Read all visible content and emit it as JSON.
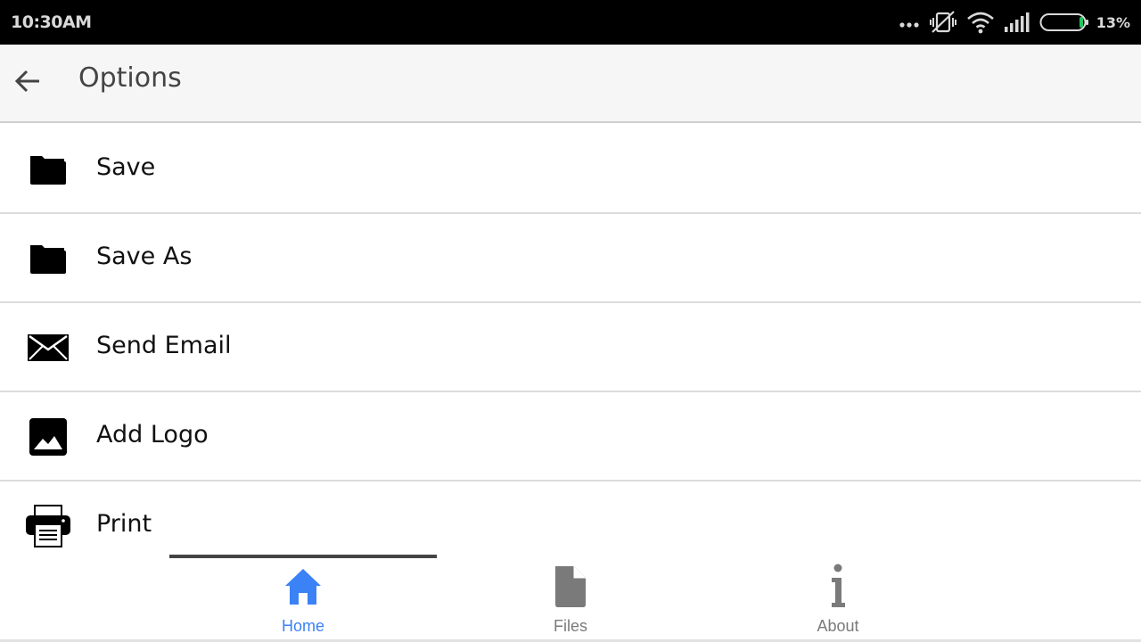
{
  "status_bar": {
    "time": "10:30AM",
    "battery_percent": "13%",
    "icons": [
      "more-dots-icon",
      "vibrate-off-icon",
      "wifi-icon",
      "signal-icon",
      "battery-icon"
    ],
    "battery_level": 0.13,
    "battery_color": "#22c55e"
  },
  "app_bar": {
    "back_icon": "back-arrow-icon",
    "title": "Options"
  },
  "options": [
    {
      "label": "Save",
      "icon": "folder-icon"
    },
    {
      "label": "Save As",
      "icon": "folder-icon"
    },
    {
      "label": "Send Email",
      "icon": "envelope-icon"
    },
    {
      "label": "Add Logo",
      "icon": "image-icon"
    },
    {
      "label": "Print",
      "icon": "printer-icon"
    }
  ],
  "bottom_nav": {
    "tabs": [
      {
        "label": "Home",
        "icon": "home-icon",
        "active": true
      },
      {
        "label": "Files",
        "icon": "file-icon",
        "active": false
      },
      {
        "label": "About",
        "icon": "info-icon",
        "active": false
      }
    ],
    "active_color": "#3b82f6",
    "inactive_color": "#7a7a7a"
  }
}
